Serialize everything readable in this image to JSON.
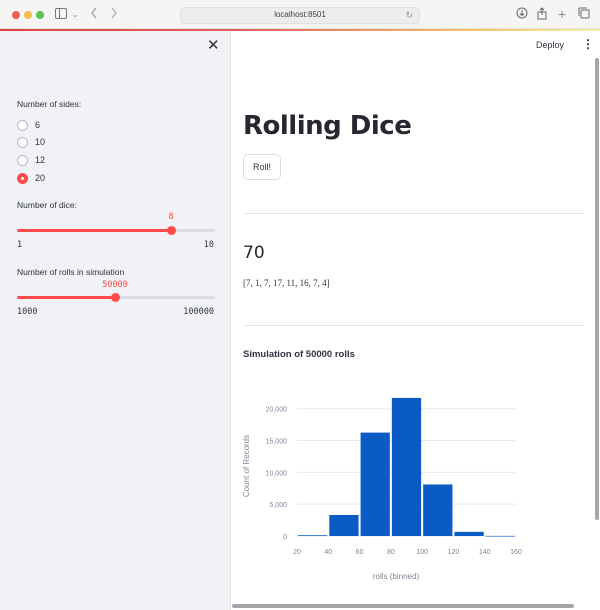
{
  "browser": {
    "url": "localhost:8501",
    "icons": [
      "sidebar-toggle-icon",
      "chevron-down-icon",
      "back-icon",
      "forward-icon",
      "reload-icon",
      "download-icon",
      "share-icon",
      "new-tab-icon",
      "tabs-overview-icon"
    ]
  },
  "header": {
    "deploy_label": "Deploy",
    "menu_icon": "kebab-menu-icon"
  },
  "sidebar": {
    "close_icon": "close-icon",
    "sides": {
      "label": "Number of sides:",
      "options": [
        "6",
        "10",
        "12",
        "20"
      ],
      "selected": "20"
    },
    "dice": {
      "label": "Number of dice:",
      "min": 1,
      "max": 10,
      "value": 8,
      "min_label": "1",
      "max_label": "10",
      "value_label": "8"
    },
    "rolls": {
      "label": "Number of rolls in simulation",
      "min": 1000,
      "max": 100000,
      "value": 50000,
      "min_label": "1000",
      "max_label": "100000",
      "value_label": "50000"
    }
  },
  "main": {
    "title": "Rolling Dice",
    "roll_button": "Roll!",
    "total": "70",
    "rolls": "[7, 1, 7, 17, 11, 16, 7, 4]",
    "chart_title": "Simulation of 50000 rolls"
  },
  "colors": {
    "accent": "#ff4b4b",
    "bar": "#0a5cc4",
    "sidebar_bg": "#f0f2f6"
  },
  "chart_data": {
    "type": "bar",
    "title": "Simulation of 50000 rolls",
    "xlabel": "rolls (binned)",
    "ylabel": "Count of Records",
    "bins": [
      [
        20,
        40
      ],
      [
        40,
        60
      ],
      [
        60,
        80
      ],
      [
        80,
        100
      ],
      [
        100,
        120
      ],
      [
        120,
        140
      ],
      [
        140,
        160
      ]
    ],
    "values": [
      120,
      3300,
      16250,
      21700,
      8100,
      650,
      10
    ],
    "x_ticks": [
      "20",
      "40",
      "60",
      "80",
      "100",
      "120",
      "140",
      "160"
    ],
    "x_range": [
      20,
      160
    ],
    "y_ticks": [
      "0",
      "5,000",
      "10,000",
      "15,000",
      "20,000"
    ],
    "y_tick_values": [
      0,
      5000,
      10000,
      15000,
      20000
    ],
    "ylim": [
      0,
      22000
    ],
    "grid": true
  }
}
